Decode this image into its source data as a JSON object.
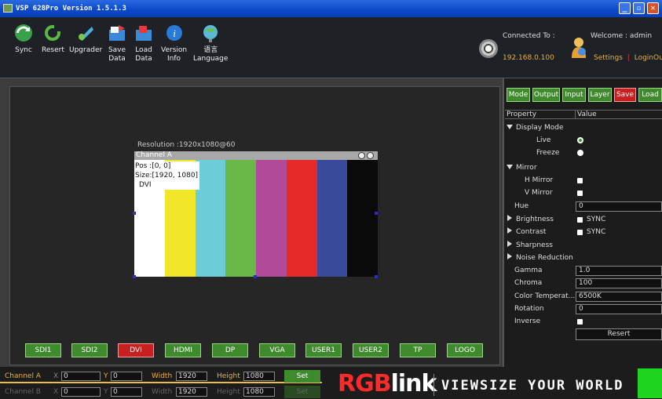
{
  "window": {
    "title": "VSP 628Pro Version 1.5.1.3"
  },
  "toolbar": {
    "buttons": [
      {
        "label": "Sync",
        "icon": "sync-icon"
      },
      {
        "label": "Resert",
        "icon": "reset-icon"
      },
      {
        "label": "Upgrader",
        "icon": "upgrader-icon"
      },
      {
        "label": "Save\nData",
        "icon": "save-data-icon"
      },
      {
        "label": "Load\nData",
        "icon": "load-data-icon"
      },
      {
        "label": "Version\nInfo",
        "icon": "info-icon"
      },
      {
        "label": "语言\nLanguage",
        "icon": "language-globe-icon"
      }
    ],
    "connected_label": "Connected To :",
    "ip": "192.168.0.100",
    "welcome": "Welcome :   admin",
    "settings": "Settings",
    "separator": "|",
    "logout": "LoginOut"
  },
  "preview": {
    "resolution": "Resolution :1920x1080@60",
    "channel_name": "Channel A",
    "pos": "Pos :[0, 0]",
    "size": "Size:[1920, 1080]",
    "source": "DVI",
    "bar_colors": [
      "#ffffff",
      "#f2e62a",
      "#6ccdd8",
      "#6ab84a",
      "#b24a9a",
      "#e62a2a",
      "#3a4a9a",
      "#0a0a0a"
    ]
  },
  "sources": {
    "buttons": [
      "SDI1",
      "SDI2",
      "DVI",
      "HDMI",
      "DP",
      "VGA",
      "USER1",
      "USER2",
      "TP",
      "LOGO"
    ],
    "active": "DVI"
  },
  "right_tabs": [
    "Mode",
    "Output",
    "Input",
    "Layer",
    "Save",
    "Load"
  ],
  "properties": {
    "header_property": "Property",
    "header_value": "Value",
    "display_mode": "Display Mode",
    "live": "Live",
    "freeze": "Freeze",
    "mirror": "Mirror",
    "h_mirror": "H Mirror",
    "v_mirror": "V Mirror",
    "hue": "Hue",
    "hue_value": "0",
    "brightness": "Brightness",
    "contrast": "Contrast",
    "sync": "SYNC",
    "sharpness": "Sharpness",
    "noise_reduction": "Noise Reduction",
    "gamma": "Gamma",
    "gamma_value": "1.0",
    "chroma": "Chroma",
    "chroma_value": "100",
    "color_temp": "Color Temperat...",
    "color_temp_value": "6500K",
    "rotation": "Rotation",
    "rotation_value": "0",
    "inverse": "Inverse",
    "resert": "Resert"
  },
  "channel_a": {
    "label": "Channel A",
    "x_label": "X",
    "x": "0",
    "y_label": "Y",
    "y": "0",
    "width_label": "Width",
    "width": "1920",
    "height_label": "Height",
    "height": "1080",
    "set": "Set"
  },
  "channel_b": {
    "label": "Channel B",
    "x_label": "X",
    "x": "0",
    "y_label": "Y",
    "y": "0",
    "width_label": "Width",
    "width": "1920",
    "height_label": "Height",
    "height": "1080",
    "set": "Set"
  },
  "brand": {
    "rgb": "RGB",
    "link": "link",
    "slogan": "VIEWSIZE YOUR WORLD"
  }
}
